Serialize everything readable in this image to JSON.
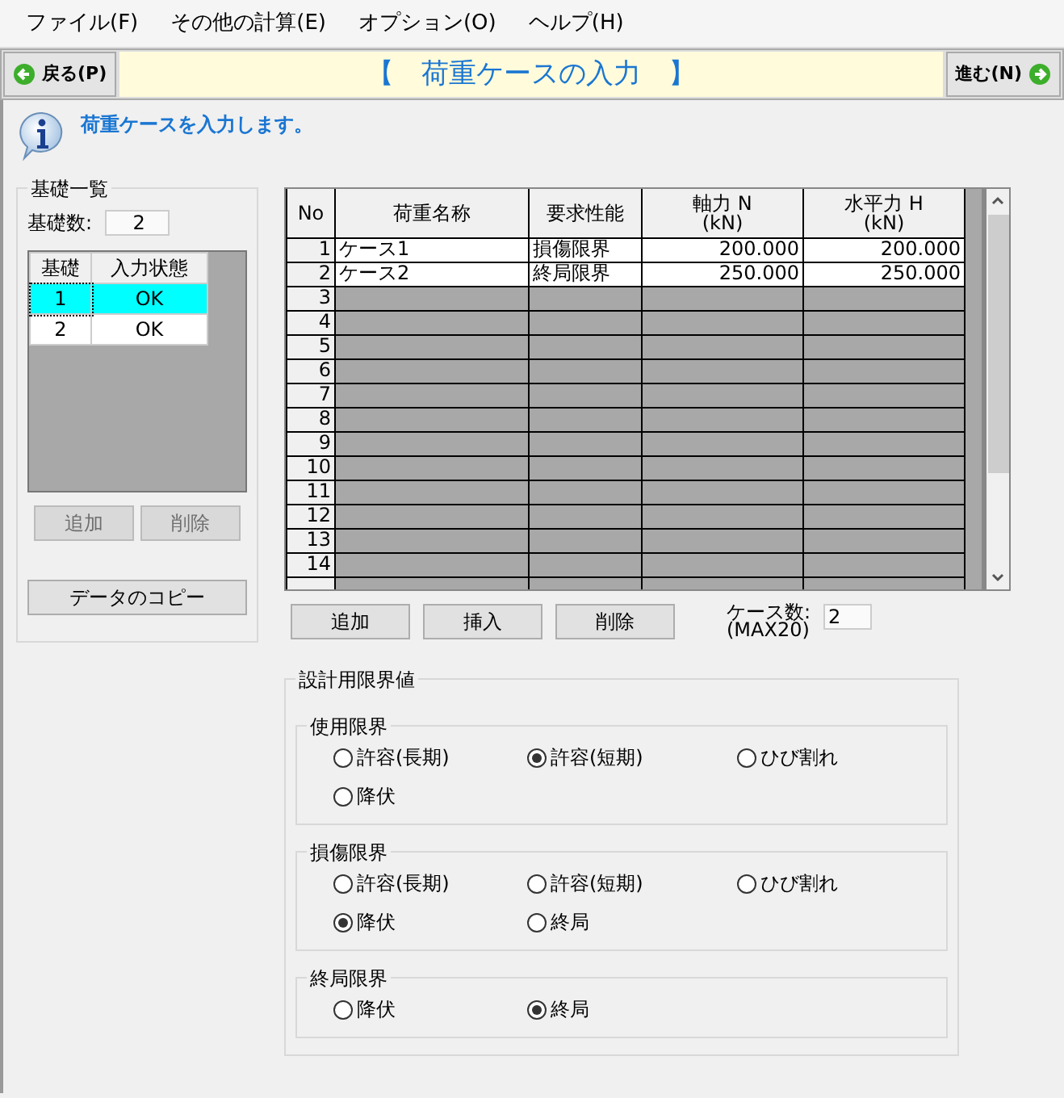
{
  "menu": [
    "ファイル(F)",
    "その他の計算(E)",
    "オプション(O)",
    "ヘルプ(H)"
  ],
  "toolbar": {
    "back": "戻る(P)",
    "title": "【　荷重ケースの入力　】",
    "next": "進む(N)"
  },
  "info": "荷重ケースを入力します。",
  "foundations": {
    "legend": "基礎一覧",
    "count_label": "基礎数:",
    "count": "2",
    "columns": [
      "基礎",
      "入力状態"
    ],
    "rows": [
      {
        "no": "1",
        "status": "OK",
        "selected": true
      },
      {
        "no": "2",
        "status": "OK",
        "selected": false
      }
    ],
    "buttons": [
      {
        "label": "追加",
        "disabled": true
      },
      {
        "label": "削除",
        "disabled": true
      }
    ],
    "copy_button": "データのコピー"
  },
  "load_table": {
    "columns": [
      "No",
      "荷重名称",
      "要求性能",
      "軸力 N\n(kN)",
      "水平力 H\n(kN)"
    ],
    "rows": [
      {
        "no": "1",
        "name": "ケース1",
        "performance": "損傷限界",
        "axial": "200.000",
        "horizontal": "200.000"
      },
      {
        "no": "2",
        "name": "ケース2",
        "performance": "終局限界",
        "axial": "250.000",
        "horizontal": "250.000"
      },
      {
        "no": "3"
      },
      {
        "no": "4"
      },
      {
        "no": "5"
      },
      {
        "no": "6"
      },
      {
        "no": "7"
      },
      {
        "no": "8"
      },
      {
        "no": "9"
      },
      {
        "no": "10"
      },
      {
        "no": "11"
      },
      {
        "no": "12"
      },
      {
        "no": "13"
      },
      {
        "no": "14"
      }
    ],
    "buttons": [
      "追加",
      "挿入",
      "削除"
    ],
    "count_label": "ケース数:\n(MAX20)",
    "count": "2"
  },
  "limits": {
    "legend": "設計用限界値",
    "groups": [
      {
        "legend": "使用限界",
        "options": [
          {
            "label": "許容(長期)",
            "selected": false
          },
          {
            "label": "許容(短期)",
            "selected": true
          },
          {
            "label": "ひび割れ",
            "selected": false
          },
          {
            "label": "降伏",
            "selected": false
          }
        ]
      },
      {
        "legend": "損傷限界",
        "options": [
          {
            "label": "許容(長期)",
            "selected": false
          },
          {
            "label": "許容(短期)",
            "selected": false
          },
          {
            "label": "ひび割れ",
            "selected": false
          },
          {
            "label": "降伏",
            "selected": true
          },
          {
            "label": "終局",
            "selected": false
          }
        ]
      },
      {
        "legend": "終局限界",
        "options": [
          {
            "label": "降伏",
            "selected": false
          },
          {
            "label": "終局",
            "selected": true
          }
        ]
      }
    ]
  }
}
